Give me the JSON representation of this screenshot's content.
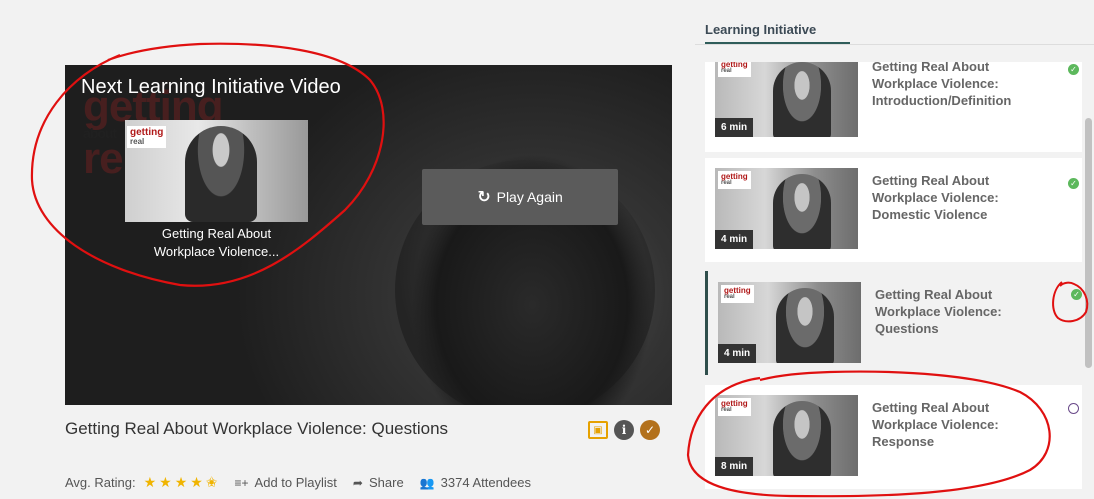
{
  "player": {
    "next_label": "Next Learning Initiative Video",
    "next_logo_main": "getting",
    "next_logo_sub": "real",
    "next_caption_line1": "Getting Real About",
    "next_caption_line2": "Workplace Violence...",
    "play_again_icon": "↻",
    "play_again_label": "Play Again"
  },
  "video": {
    "title": "Getting Real About Workplace Violence: Questions",
    "icons": [
      "certificate-icon",
      "info-icon",
      "completed-check-icon"
    ],
    "avg_rating_label": "Avg. Rating:",
    "rating": 4.5,
    "rating_stars": "★★★★✬",
    "playlist_label": "Add to Playlist",
    "share_label": "Share",
    "attendees_label": "3374 Attendees"
  },
  "sidebar": {
    "tab_label": "Learning Initiative",
    "items": [
      {
        "title": "Getting Real About Workplace Violence: Introduction/Definition",
        "duration": "6 min",
        "status": "completed",
        "active": false
      },
      {
        "title": "Getting Real About Workplace Violence: Domestic Violence",
        "duration": "4 min",
        "status": "completed",
        "active": false
      },
      {
        "title": "Getting Real About Workplace Violence: Questions",
        "duration": "4 min",
        "status": "completed",
        "active": true
      },
      {
        "title": "Getting Real About Workplace Violence: Response",
        "duration": "8 min",
        "status": "not-started",
        "active": false
      }
    ]
  },
  "colors": {
    "completed": "#5cb85c",
    "active_border": "#2f4f4c",
    "rating": "#f0b400",
    "annotation": "#e01010"
  }
}
